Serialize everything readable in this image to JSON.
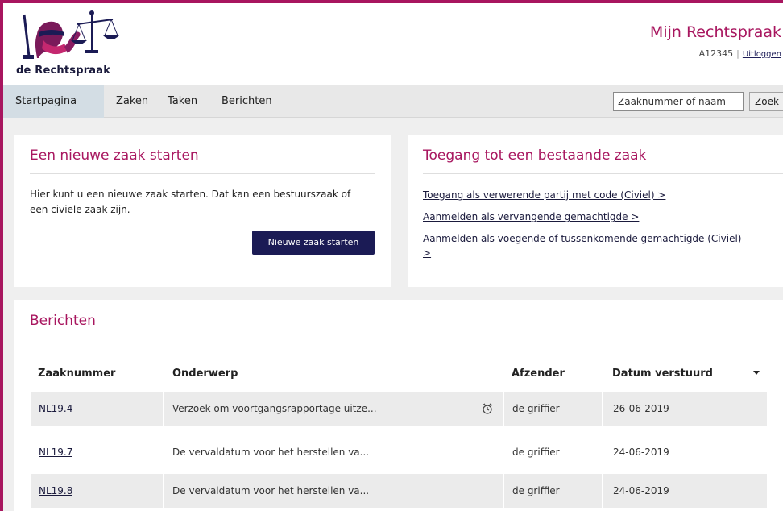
{
  "header": {
    "logo_text": "de Rechtspraak",
    "app_title": "Mijn Rechtspraak",
    "user_id": "A12345",
    "separator": "|",
    "logout_label": "Uitloggen"
  },
  "nav": {
    "tabs": [
      {
        "label": "Startpagina",
        "active": true
      },
      {
        "label": "Zaken",
        "active": false
      },
      {
        "label": "Taken",
        "active": false
      },
      {
        "label": "Berichten",
        "active": false
      }
    ],
    "search_value": "Zaaknummer of naam",
    "search_button": "Zoek"
  },
  "new_case": {
    "title": "Een nieuwe zaak starten",
    "text_line1": "Hier kunt u een nieuwe zaak starten. Dat kan een bestuurszaak of",
    "text_line2": "een civiele zaak zijn.",
    "button": "Nieuwe zaak starten"
  },
  "access": {
    "title": "Toegang tot een bestaande zaak",
    "links": [
      "Toegang als verwerende partij met code (Civiel) >",
      "Aanmelden als vervangende gemachtigde >",
      "Aanmelden als voegende of tussenkomende gemachtigde (Civiel)",
      ">"
    ]
  },
  "messages": {
    "title": "Berichten",
    "columns": [
      "Zaaknummer",
      "Onderwerp",
      "Afzender",
      "Datum verstuurd"
    ],
    "rows": [
      {
        "case": "NL19.4",
        "subject": "Verzoek om voortgangsrapportage uitze...",
        "sender": "de griffier",
        "date": "26-06-2019",
        "alarm": true
      },
      {
        "case": "NL19.7",
        "subject": "De vervaldatum voor het herstellen va...",
        "sender": "de griffier",
        "date": "24-06-2019",
        "alarm": false
      },
      {
        "case": "NL19.8",
        "subject": "De vervaldatum voor het herstellen va...",
        "sender": "de griffier",
        "date": "24-06-2019",
        "alarm": false
      }
    ]
  },
  "colors": {
    "brand": "#a8165f",
    "navy": "#1b1b55",
    "active_tab": "#d3dde4"
  }
}
